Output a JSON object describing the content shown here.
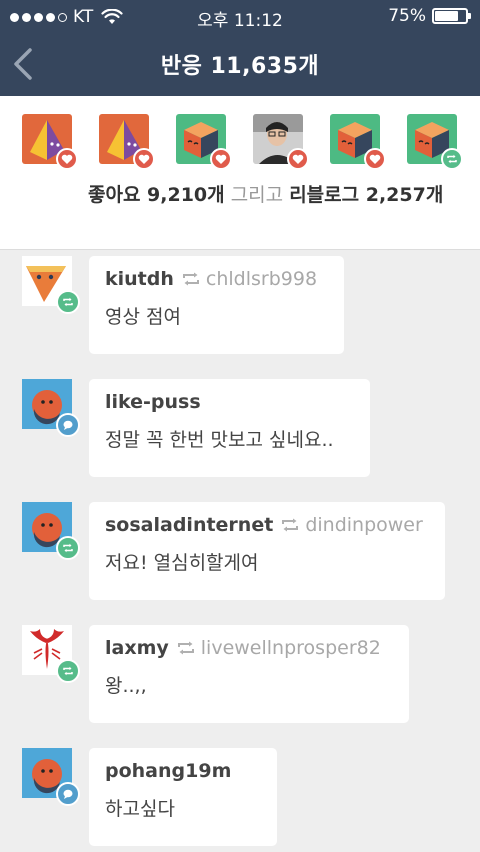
{
  "status_bar": {
    "carrier": "KT",
    "time": "오후 11:12",
    "battery": "75%",
    "battery_level": 0.75
  },
  "header": {
    "back_icon": "chevron-left-icon",
    "title": "반응 11,635개"
  },
  "summary": {
    "likes": "좋아요 9,210개",
    "connector": "그리고",
    "reblogs": "리블로그 2,257개"
  },
  "recent_avatars": [
    {
      "avatar": "orange-pyramid",
      "badge": "heart-icon"
    },
    {
      "avatar": "orange-pyramid",
      "badge": "heart-icon"
    },
    {
      "avatar": "green-cube",
      "badge": "heart-icon"
    },
    {
      "avatar": "photo-person",
      "badge": "heart-icon"
    },
    {
      "avatar": "green-cube",
      "badge": "heart-icon"
    },
    {
      "avatar": "green-cube",
      "badge": "reblog-icon"
    }
  ],
  "notes": [
    {
      "username": "kiutdh",
      "via": "chldlsrb998",
      "type": "reblog",
      "text": "영상 점여"
    },
    {
      "username": "like-puss",
      "via": "",
      "type": "reply",
      "text": "정말 꼭 한번 맛보고 싶네요.."
    },
    {
      "username": "sosaladinternet",
      "via": "dindinpower",
      "type": "reblog",
      "text": "저요! 열심히할게여"
    },
    {
      "username": "laxmy",
      "via": "livewellnprosper82",
      "type": "reblog",
      "text": "왕..,,"
    },
    {
      "username": "pohang19m",
      "via": "",
      "type": "reply",
      "text": "하고싶다"
    }
  ],
  "colors": {
    "header": "#36465d",
    "like": "#e05b4b",
    "reblog": "#56bc8a",
    "reply": "#529ecc"
  }
}
